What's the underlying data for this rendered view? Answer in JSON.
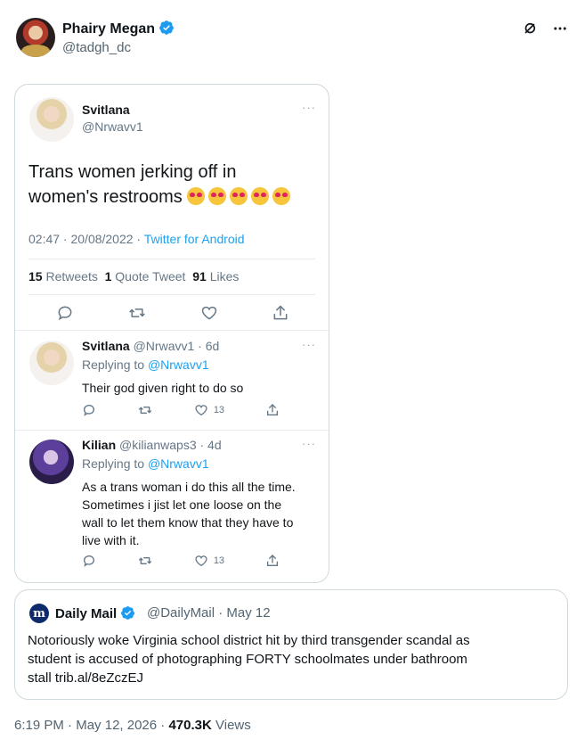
{
  "post": {
    "author_name": "Phairy Megan",
    "author_handle": "@tadgh_dc",
    "timestamp": "6:19 PM",
    "date": "May 12, 2026",
    "views_count": "470.3K",
    "views_label": "Views",
    "separator": "·"
  },
  "screenshot": {
    "main": {
      "name": "Svitlana",
      "handle": "@Nrwavv1",
      "text_line1": "Trans women jerking off in",
      "text_line2": "women's restrooms",
      "emoji_count": 5,
      "time": "02:47 · 20/08/2022 ·",
      "source": "Twitter for Android",
      "retweets_count": "15",
      "retweets_label": "Retweets",
      "quotes_count": "1",
      "quotes_label": "Quote Tweet",
      "likes_count": "91",
      "likes_label": "Likes"
    },
    "reply1": {
      "name": "Svitlana",
      "handle_time": "@Nrwavv1 · 6d",
      "replying_label": "Replying to",
      "replying_handle": "@Nrwavv1",
      "text": "Their god given right to do so",
      "like_count": "13"
    },
    "reply2": {
      "name": "Kilian",
      "handle_time": "@kilianwaps3 · 4d",
      "replying_label": "Replying to",
      "replying_handle": "@Nrwavv1",
      "text_lines": [
        "As a trans woman i do this all the time.",
        "Sometimes i jist let one loose on the",
        "wall to let them know that they have to",
        "live with it."
      ],
      "like_count": "13"
    }
  },
  "quote": {
    "logo_letter": "m",
    "name": "Daily Mail",
    "handle": "@DailyMail",
    "separator": "·",
    "date": "May 12",
    "text_lines": [
      "Notoriously woke Virginia school district hit by third transgender scandal as",
      "student is accused of photographing FORTY schoolmates under bathroom",
      "stall trib.al/8eZczEJ"
    ]
  },
  "colors": {
    "verified": "#1d9bf0",
    "link": "#1da1f2",
    "muted": "#536471",
    "text": "#0f1419",
    "border": "#cfd9de"
  },
  "icons": [
    "verified-badge-icon",
    "grok-icon",
    "more-icon",
    "reply-icon",
    "retweet-icon",
    "like-icon",
    "share-icon"
  ]
}
